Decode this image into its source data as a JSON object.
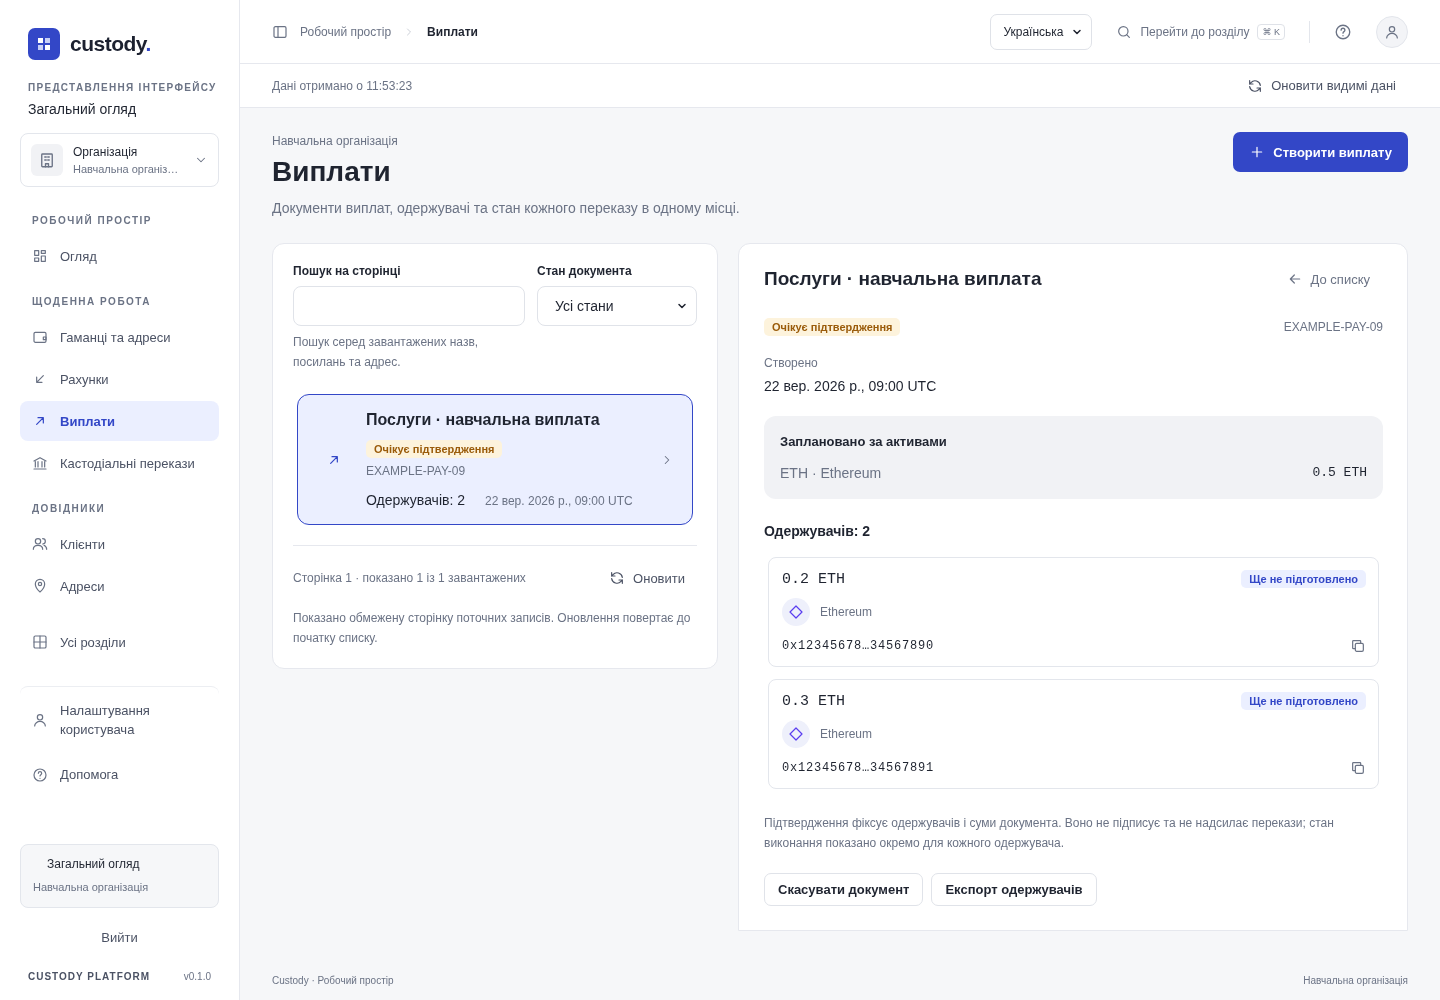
{
  "sidebar": {
    "brand": "custody.",
    "view_label": "ПРЕДСТАВЛЕННЯ ІНТЕРФЕЙСУ",
    "view": "Загальний огляд",
    "org_selector": {
      "label": "Організація",
      "value": "Навчальна організ…"
    },
    "sections": [
      {
        "heading": "РОБОЧИЙ ПРОСТІР",
        "items": [
          {
            "label": "Огляд",
            "selected": false
          }
        ]
      },
      {
        "heading": "ЩОДЕННА РОБОТА",
        "items": [
          {
            "label": "Гаманці та адреси",
            "selected": false
          },
          {
            "label": "Рахунки",
            "selected": false
          },
          {
            "label": "Виплати",
            "selected": true
          },
          {
            "label": "Кастодіальні перекази",
            "selected": false
          }
        ]
      },
      {
        "heading": "ДОВІДНИКИ",
        "items": [
          {
            "label": "Клієнти",
            "selected": false
          },
          {
            "label": "Адреси",
            "selected": false
          }
        ]
      },
      {
        "items": [
          {
            "label": "Усі розділи",
            "selected": false
          }
        ]
      }
    ],
    "user_menu": [
      "Налаштування користувача",
      "Допомога"
    ],
    "context": {
      "title": "Загальний огляд",
      "subtitle": "Навчальна організація"
    },
    "logout": "Вийти",
    "footer": {
      "product": "CUSTODY PLATFORM",
      "version": "v0.1.0"
    }
  },
  "topbar": {
    "breadcrumb": [
      "Робочий простір",
      "Виплати"
    ],
    "language": "Українська",
    "search": {
      "placeholder": "Перейти до розділу",
      "shortcut": "⌘ K"
    }
  },
  "status_bar": {
    "fetched": "Дані отримано о 11:53:23",
    "refresh": "Оновити видимі дані"
  },
  "page": {
    "org": "Навчальна організація",
    "title": "Виплати",
    "description": "Документи виплат, одержувачі та стан кожного переказу в одному місці.",
    "create": "Створити виплату"
  },
  "list_panel": {
    "search_label": "Пошук на сторінці",
    "status_label": "Стан документа",
    "status_value": "Усі стани",
    "hint": "Пошук серед завантажених назв, посилань та адрес.",
    "items": [
      {
        "title": "Послуги · навчальна виплата",
        "badge": {
          "text": "Очікує підтвердження",
          "kind": "pending"
        },
        "reference": "EXAMPLE-PAY-09",
        "recipients": "Одержувачів: 2",
        "date": "22 вер. 2026 р., 09:00 UTC",
        "selected": true
      }
    ],
    "pager": "Сторінка 1 · показано 1 із 1 завантажених",
    "refresh": "Оновити",
    "note": "Показано обмежену сторінку поточних записів. Оновлення повертає до початку списку."
  },
  "detail": {
    "title": "Послуги · навчальна виплата",
    "back": "До списку",
    "badge": {
      "text": "Очікує підтвердження",
      "kind": "pending"
    },
    "reference": "EXAMPLE-PAY-09",
    "created_label": "Створено",
    "created": "22 вер. 2026 р., 09:00 UTC",
    "planned": {
      "title": "Заплановано за активами",
      "asset": "ETH · Ethereum",
      "amount": "0.5 ETH"
    },
    "recipients_heading": "Одержувачів: 2",
    "recipients": [
      {
        "amount": "0.2 ETH",
        "badge": {
          "text": "Ще не підготовлено",
          "kind": "not_ready"
        },
        "network": "Ethereum",
        "address": "0x12345678…34567890"
      },
      {
        "amount": "0.3 ETH",
        "badge": {
          "text": "Ще не підготовлено",
          "kind": "not_ready"
        },
        "network": "Ethereum",
        "address": "0x12345678…34567891"
      }
    ],
    "note": "Підтвердження фіксує одержувачів і суми документа. Воно не підписує та не надсилає перекази; стан виконання показано окремо для кожного одержувача.",
    "buttons": [
      "Скасувати документ",
      "Експорт одержувачів"
    ]
  },
  "footer": {
    "left": "Custody · Робочий простір",
    "right": "Навчальна організація"
  }
}
